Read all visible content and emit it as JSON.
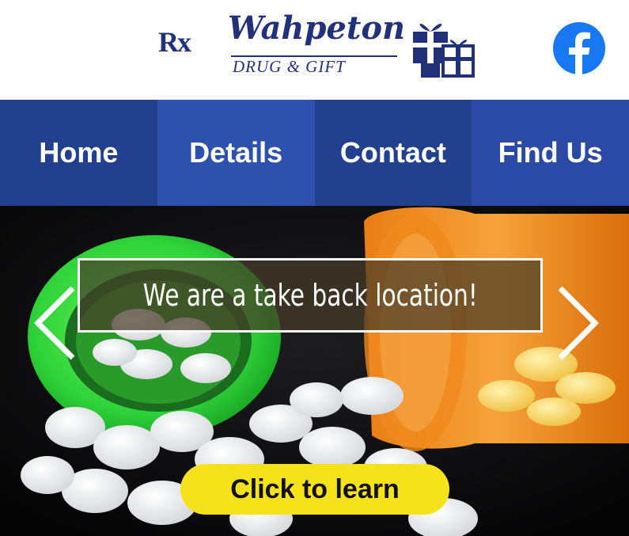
{
  "header": {
    "logo": {
      "rx": "Rx",
      "name": "Wahpeton",
      "tagline": "DRUG & GIFT"
    },
    "social_icon": "facebook-icon"
  },
  "nav": {
    "items": [
      {
        "label": "Home"
      },
      {
        "label": "Details"
      },
      {
        "label": "Contact"
      },
      {
        "label": "Find Us"
      }
    ]
  },
  "hero": {
    "caption": "We are a take back location!",
    "cta_label": "Click to learn",
    "prev_icon": "chevron-left-icon",
    "next_icon": "chevron-right-icon"
  },
  "colors": {
    "brand_navy": "#23307a",
    "nav_blue": "#2a4aa5",
    "facebook_blue": "#1877f2",
    "cta_yellow": "#f6e21a"
  }
}
